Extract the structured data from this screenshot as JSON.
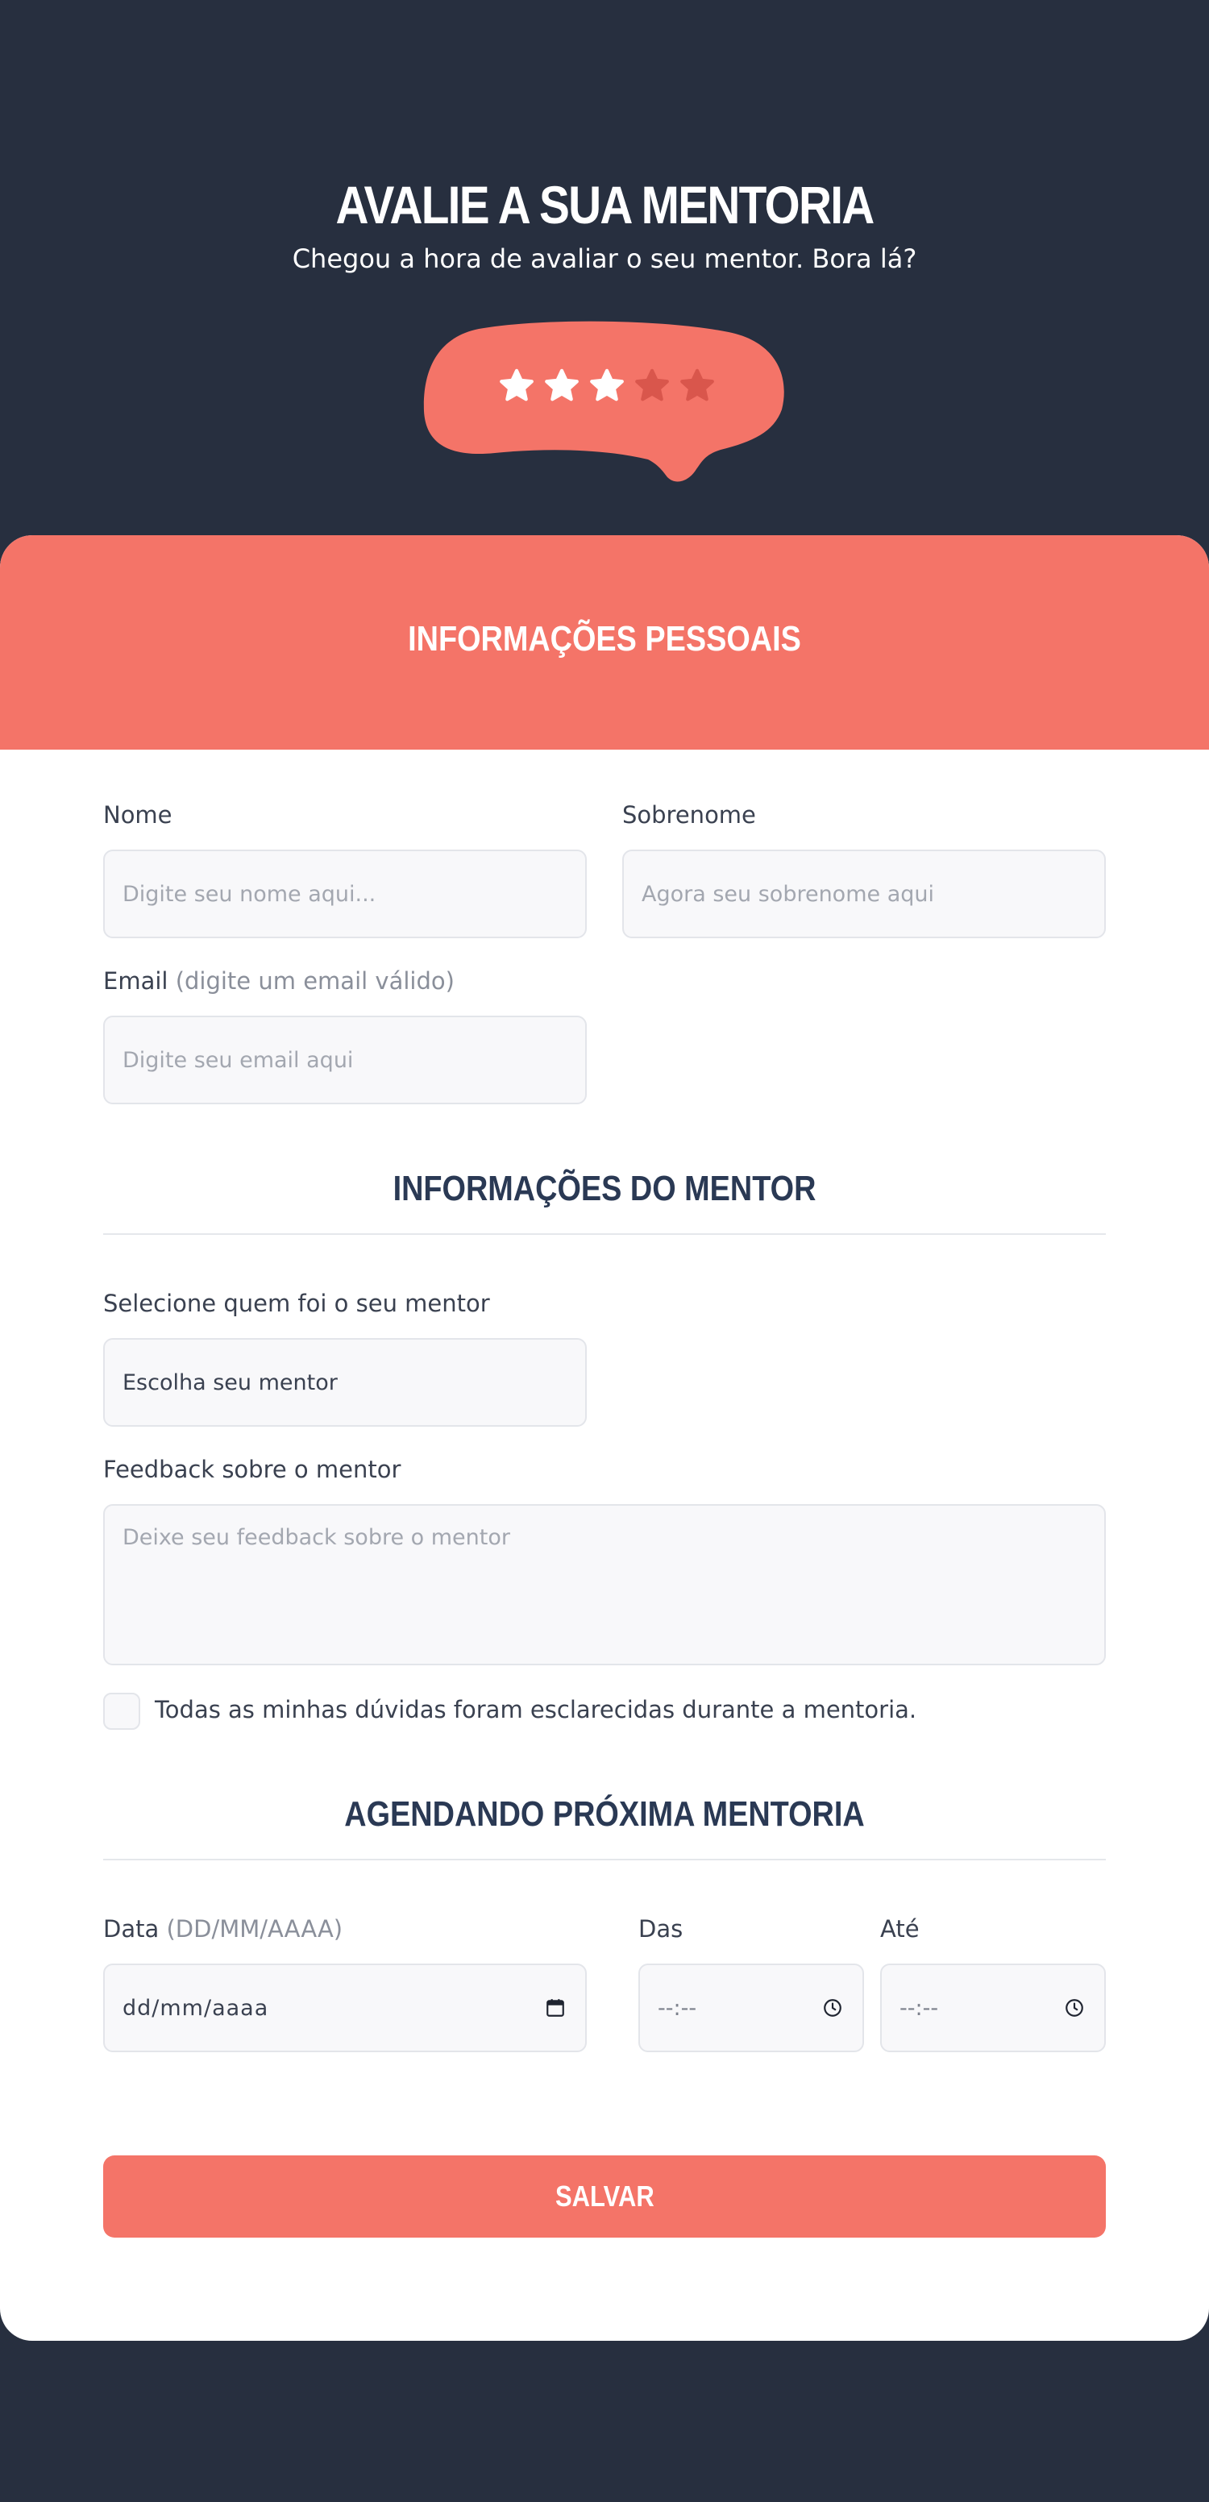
{
  "hero": {
    "title": "AVALIE A SUA MENTORIA",
    "subtitle": "Chegou a hora de avaliar o seu mentor. Bora lá?",
    "rating": {
      "value": 3,
      "max": 5
    },
    "colors": {
      "bubble": "#f47468",
      "star_active": "#ffffff",
      "star_inactive": "#d9564c"
    }
  },
  "personal": {
    "title": "INFORMAÇÕES PESSOAIS",
    "name_label": "Nome",
    "name_placeholder": "Digite seu nome aqui...",
    "surname_label": "Sobrenome",
    "surname_placeholder": "Agora seu sobrenome aqui",
    "email_label": "Email",
    "email_hint": "(digite um email válido)",
    "email_placeholder": "Digite seu email aqui"
  },
  "mentor": {
    "title": "INFORMAÇÕES DO MENTOR",
    "select_label": "Selecione quem foi o seu mentor",
    "select_value": "Escolha seu mentor",
    "feedback_label": "Feedback sobre o mentor",
    "feedback_placeholder": "Deixe seu feedback sobre o mentor",
    "checkbox_label": "Todas as minhas dúvidas foram esclarecidas durante a mentoria.",
    "checkbox_checked": false
  },
  "schedule": {
    "title": "AGENDANDO PRÓXIMA MENTORIA",
    "date_label": "Data",
    "date_hint": "(DD/MM/AAAA)",
    "date_value": "dd/mm/aaaa",
    "from_label": "Das",
    "from_value": "--:--",
    "to_label": "Até",
    "to_value": "--:--"
  },
  "actions": {
    "save_label": "SALVAR"
  },
  "colors": {
    "background": "#272f3f",
    "accent": "#f47468",
    "heading": "#2a3954"
  }
}
